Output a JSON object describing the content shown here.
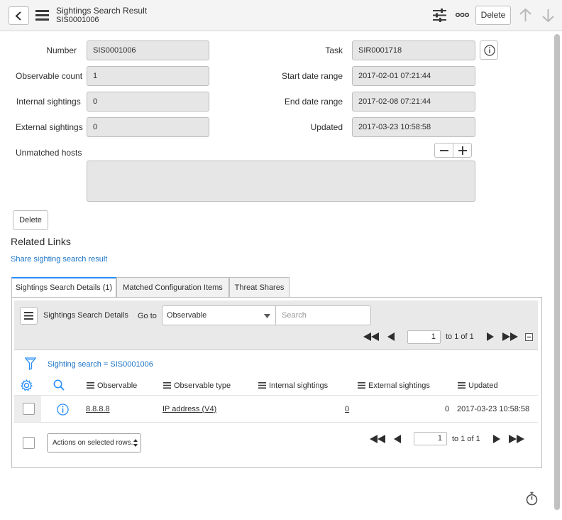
{
  "header": {
    "title": "Sightings Search Result",
    "subtitle": "SIS0001006",
    "delete_label": "Delete"
  },
  "form": {
    "number": {
      "label": "Number",
      "value": "SIS0001006"
    },
    "observable_count": {
      "label": "Observable count",
      "value": "1"
    },
    "internal_sightings": {
      "label": "Internal sightings",
      "value": "0"
    },
    "external_sightings": {
      "label": "External sightings",
      "value": "0"
    },
    "unmatched_hosts": {
      "label": "Unmatched hosts",
      "value": ""
    },
    "task": {
      "label": "Task",
      "value": "SIR0001718"
    },
    "start_date_range": {
      "label": "Start date range",
      "value": "2017-02-01 07:21:44"
    },
    "end_date_range": {
      "label": "End date range",
      "value": "2017-02-08 07:21:44"
    },
    "updated": {
      "label": "Updated",
      "value": "2017-03-23 10:58:58"
    },
    "delete_label": "Delete"
  },
  "related": {
    "title": "Related Links",
    "share_link": "Share sighting search result"
  },
  "tabs": [
    {
      "label": "Sightings Search Details (1)",
      "active": true
    },
    {
      "label": "Matched Configuration Items",
      "active": false
    },
    {
      "label": "Threat Shares",
      "active": false
    }
  ],
  "list": {
    "title": "Sightings Search Details",
    "goto_label": "Go to",
    "goto_selected": "Observable",
    "search_placeholder": "Search",
    "page": {
      "current": "1",
      "of_text": "to 1 of 1"
    },
    "filter_text": "Sighting search = SIS0001006",
    "columns": [
      "Observable",
      "Observable type",
      "Internal sightings",
      "External sightings",
      "Updated"
    ],
    "rows": [
      {
        "observable": "8.8.8.8",
        "observable_type": "IP address (V4)",
        "internal_sightings": "0",
        "external_sightings": "0",
        "updated": "2017-03-23 10:58:58"
      }
    ],
    "actions_placeholder": "Actions on selected rows..."
  },
  "icons": {
    "back": "chevron-left-icon",
    "menu": "hamburger-icon",
    "personalize": "sliders-icon",
    "more": "ellipsis-icon",
    "prev_record": "arrow-up-icon",
    "next_record": "arrow-down-icon",
    "info": "info-icon",
    "filter": "funnel-icon",
    "settings": "gear-icon",
    "search": "search-icon",
    "timer": "stopwatch-icon"
  },
  "colors": {
    "link": "#1a73c6",
    "tab_accent": "#278efc",
    "field_bg": "#e6e6e6"
  }
}
